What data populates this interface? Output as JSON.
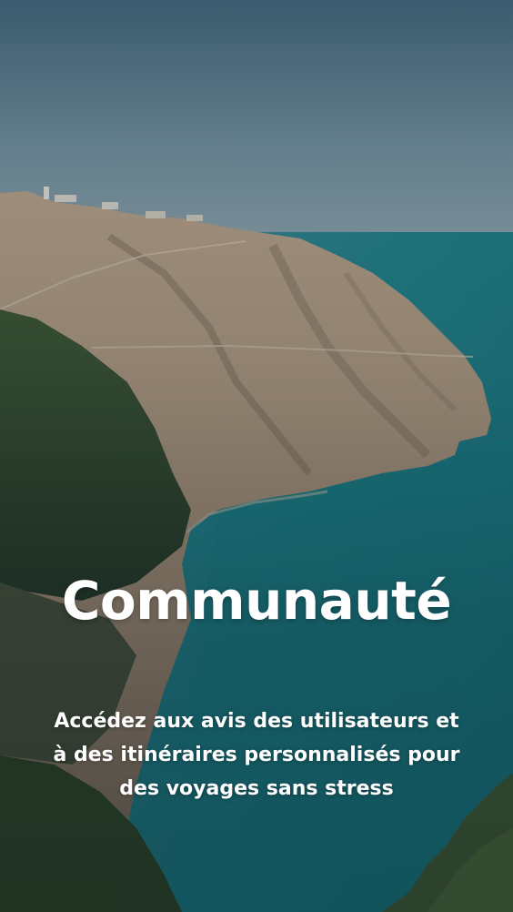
{
  "screen": {
    "title": "Communauté",
    "subtitle": "Accédez aux avis des utilisateurs et à des itinéraires personnalisés pour des voyages sans stress"
  },
  "background": {
    "image_subject": "coastal-cliff-landscape",
    "colors": {
      "sky_top": "#3f6277",
      "sky_horizon": "#8aa1ab",
      "sea": "#1f7f87",
      "cliff": "#a48f78",
      "vegetation": "#2f4a2e"
    }
  }
}
